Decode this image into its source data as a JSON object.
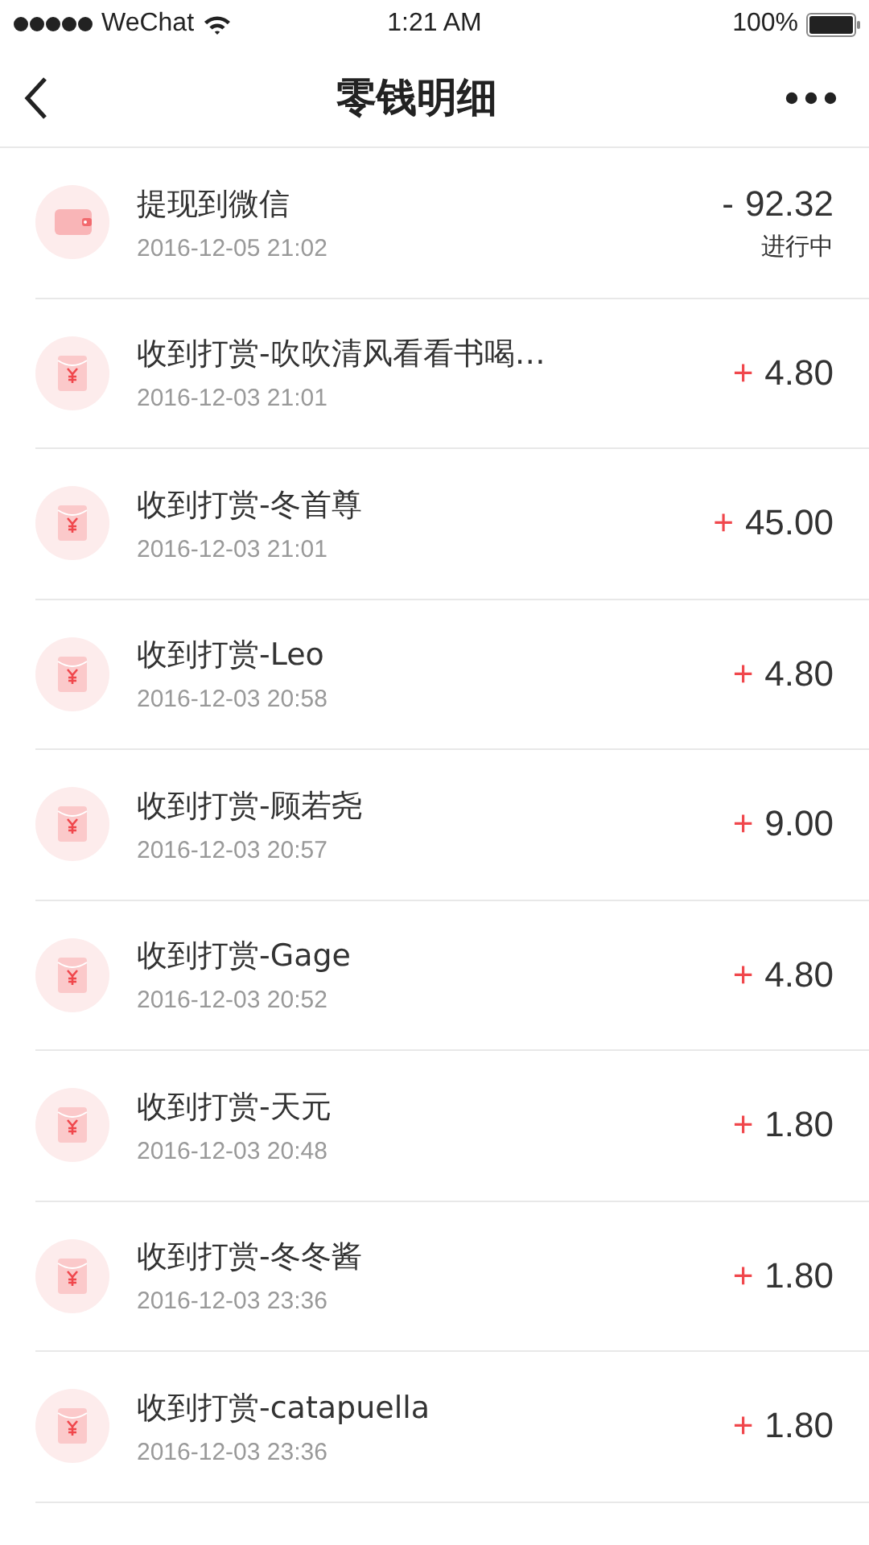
{
  "status_bar": {
    "carrier": "WeChat",
    "time": "1:21 AM",
    "battery": "100%"
  },
  "nav": {
    "title": "零钱明细"
  },
  "records": [
    {
      "kind": "withdraw",
      "title": "提现到微信",
      "date": "2016-12-05 21:02",
      "sign": "-",
      "amount": "92.32",
      "status": "进行中"
    },
    {
      "kind": "reward",
      "title": "收到打赏-吹吹清风看看书喝…",
      "date": "2016-12-03 21:01",
      "sign": "+",
      "amount": "4.80"
    },
    {
      "kind": "reward",
      "title": "收到打赏-冬首尊",
      "date": "2016-12-03 21:01",
      "sign": "+",
      "amount": "45.00"
    },
    {
      "kind": "reward",
      "title": "收到打赏-Leo",
      "date": "2016-12-03 20:58",
      "sign": "+",
      "amount": "4.80"
    },
    {
      "kind": "reward",
      "title": "收到打赏-顾若尧",
      "date": "2016-12-03 20:57",
      "sign": "+",
      "amount": "9.00"
    },
    {
      "kind": "reward",
      "title": "收到打赏-Gage",
      "date": "2016-12-03 20:52",
      "sign": "+",
      "amount": "4.80"
    },
    {
      "kind": "reward",
      "title": "收到打赏-天元",
      "date": "2016-12-03 20:48",
      "sign": "+",
      "amount": "1.80"
    },
    {
      "kind": "reward",
      "title": "收到打赏-冬冬酱",
      "date": "2016-12-03 23:36",
      "sign": "+",
      "amount": "1.80"
    },
    {
      "kind": "reward",
      "title": "收到打赏-catapuella",
      "date": "2016-12-03 23:36",
      "sign": "+",
      "amount": "1.80"
    }
  ]
}
